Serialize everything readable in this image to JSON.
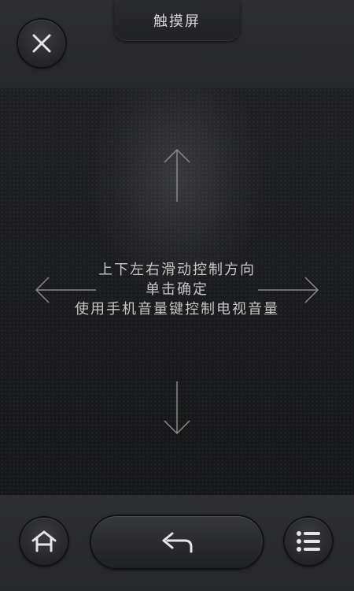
{
  "header": {
    "title": "触摸屏",
    "close_icon": "close-icon"
  },
  "touchpad": {
    "instructions": [
      "上下左右滑动控制方向",
      "单击确定",
      "使用手机音量键控制电视音量"
    ],
    "arrows": [
      "arrow-up-icon",
      "arrow-down-icon",
      "arrow-left-icon",
      "arrow-right-icon"
    ]
  },
  "footer": {
    "home_icon": "home-icon",
    "back_icon": "back-icon",
    "menu_icon": "menu-icon"
  },
  "colors": {
    "background": "#2a2b2f",
    "touchpad": "#1a1b1e",
    "text": "#c6c6c6"
  }
}
